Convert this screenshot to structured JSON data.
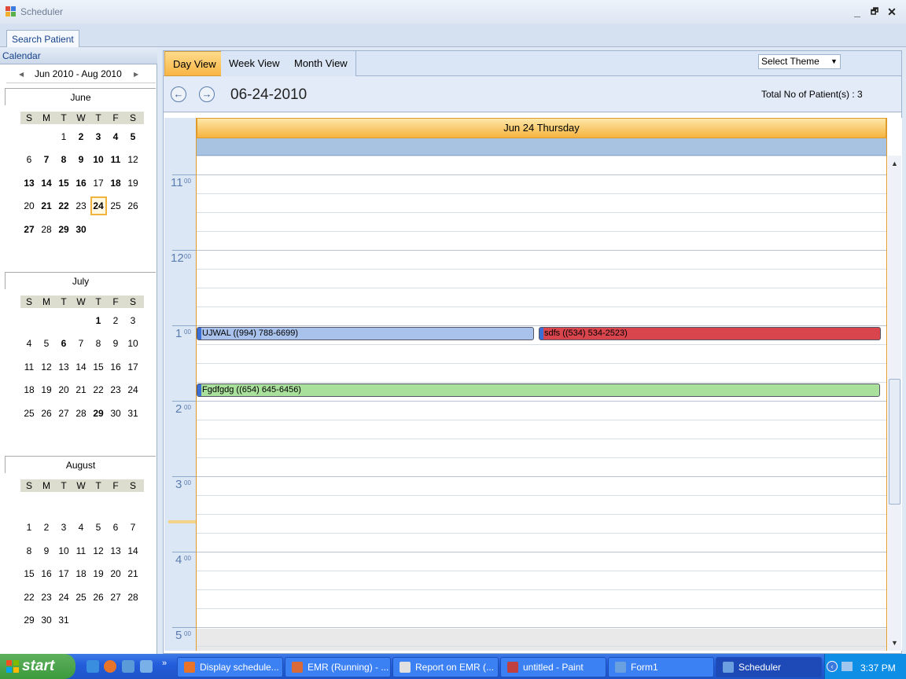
{
  "window": {
    "title": "Scheduler",
    "minimize": "_",
    "maximize": "🗗",
    "close": "✕"
  },
  "toptab": {
    "label": "Search Patient"
  },
  "calendar": {
    "label": "Calendar",
    "range": "Jun 2010 - Aug 2010",
    "dow": [
      "S",
      "M",
      "T",
      "W",
      "T",
      "F",
      "S"
    ],
    "months": [
      {
        "name": "June",
        "weeks": [
          [
            "",
            "",
            "1",
            "2",
            "3",
            "4",
            "5"
          ],
          [
            "6",
            "7",
            "8",
            "9",
            "10",
            "11",
            "12"
          ],
          [
            "13",
            "14",
            "15",
            "16",
            "17",
            "18",
            "19"
          ],
          [
            "20",
            "21",
            "22",
            "23",
            "24",
            "25",
            "26"
          ],
          [
            "27",
            "28",
            "29",
            "30",
            "",
            "",
            ""
          ]
        ],
        "bold": [
          "2",
          "3",
          "4",
          "5",
          "7",
          "8",
          "9",
          "10",
          "11",
          "13",
          "14",
          "15",
          "16",
          "18",
          "21",
          "22",
          "24",
          "27",
          "29",
          "30"
        ],
        "selected": "24"
      },
      {
        "name": "July",
        "weeks": [
          [
            "",
            "",
            "",
            "",
            "1",
            "2",
            "3"
          ],
          [
            "4",
            "5",
            "6",
            "7",
            "8",
            "9",
            "10"
          ],
          [
            "11",
            "12",
            "13",
            "14",
            "15",
            "16",
            "17"
          ],
          [
            "18",
            "19",
            "20",
            "21",
            "22",
            "23",
            "24"
          ],
          [
            "25",
            "26",
            "27",
            "28",
            "29",
            "30",
            "31"
          ]
        ],
        "bold": [
          "1",
          "6",
          "29"
        ]
      },
      {
        "name": "August",
        "weeks": [
          [
            "",
            "",
            "",
            "",
            "",
            "",
            ""
          ],
          [
            "1",
            "2",
            "3",
            "4",
            "5",
            "6",
            "7"
          ],
          [
            "8",
            "9",
            "10",
            "11",
            "12",
            "13",
            "14"
          ],
          [
            "15",
            "16",
            "17",
            "18",
            "19",
            "20",
            "21"
          ],
          [
            "22",
            "23",
            "24",
            "25",
            "26",
            "27",
            "28"
          ],
          [
            "29",
            "30",
            "31",
            "",
            "",
            "",
            ""
          ]
        ],
        "bold": []
      }
    ]
  },
  "views": {
    "day": "Day View",
    "week": "Week View",
    "month": "Month View"
  },
  "theme": {
    "placeholder": "Select Theme"
  },
  "nav": {
    "prev": "←",
    "next": "→",
    "date": "06-24-2010",
    "total": "Total No of Patient(s) : 3"
  },
  "day_header": "Jun 24 Thursday",
  "hours": [
    {
      "num": "11",
      "sup": "00"
    },
    {
      "num": "12",
      "sup": "00"
    },
    {
      "num": "1",
      "sup": "00"
    },
    {
      "num": "2",
      "sup": "00"
    },
    {
      "num": "3",
      "sup": "00"
    },
    {
      "num": "4",
      "sup": "00"
    },
    {
      "num": "5",
      "sup": "00"
    }
  ],
  "appointments": [
    {
      "label": "UJWAL ((994) 788-6699)",
      "color": "#a8c2ec"
    },
    {
      "label": "sdfs ((534) 534-2523)",
      "color": "#d9454c"
    },
    {
      "label": "Fgdfgdg ((654) 645-6456)",
      "color": "#a9e09c"
    }
  ],
  "taskbar": {
    "start": "start",
    "tasks": [
      "Display schedule...",
      "EMR (Running) - ...",
      "Report on EMR (...",
      "untitled - Paint",
      "Form1",
      "Scheduler"
    ],
    "clock": "3:37 PM"
  }
}
